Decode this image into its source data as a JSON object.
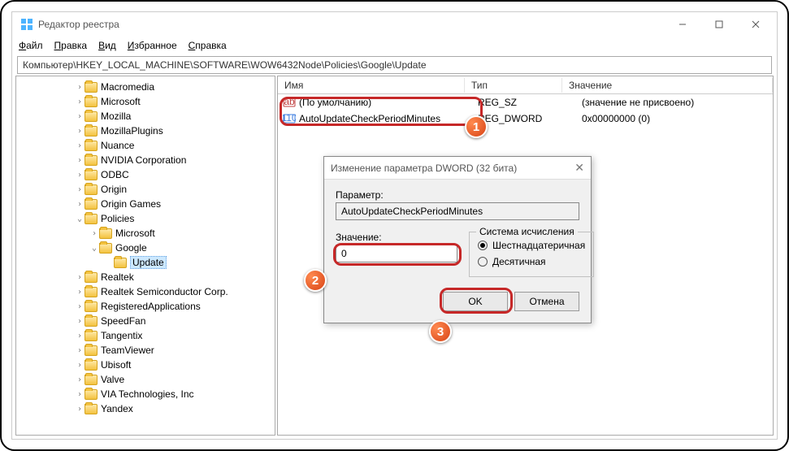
{
  "title": "Редактор реестра",
  "menu": [
    "Файл",
    "Правка",
    "Вид",
    "Избранное",
    "Справка"
  ],
  "path": "Компьютер\\HKEY_LOCAL_MACHINE\\SOFTWARE\\WOW6432Node\\Policies\\Google\\Update",
  "tree": [
    {
      "d": 4,
      "t": ">",
      "n": "Macromedia"
    },
    {
      "d": 4,
      "t": ">",
      "n": "Microsoft"
    },
    {
      "d": 4,
      "t": ">",
      "n": "Mozilla"
    },
    {
      "d": 4,
      "t": ">",
      "n": "MozillaPlugins"
    },
    {
      "d": 4,
      "t": ">",
      "n": "Nuance"
    },
    {
      "d": 4,
      "t": ">",
      "n": "NVIDIA Corporation"
    },
    {
      "d": 4,
      "t": ">",
      "n": "ODBC"
    },
    {
      "d": 4,
      "t": ">",
      "n": "Origin"
    },
    {
      "d": 4,
      "t": ">",
      "n": "Origin Games"
    },
    {
      "d": 4,
      "t": "v",
      "n": "Policies"
    },
    {
      "d": 5,
      "t": ">",
      "n": "Microsoft"
    },
    {
      "d": 5,
      "t": "v",
      "n": "Google"
    },
    {
      "d": 6,
      "t": "",
      "n": "Update",
      "sel": true
    },
    {
      "d": 4,
      "t": ">",
      "n": "Realtek"
    },
    {
      "d": 4,
      "t": ">",
      "n": "Realtek Semiconductor Corp."
    },
    {
      "d": 4,
      "t": ">",
      "n": "RegisteredApplications"
    },
    {
      "d": 4,
      "t": ">",
      "n": "SpeedFan"
    },
    {
      "d": 4,
      "t": ">",
      "n": "Tangentix"
    },
    {
      "d": 4,
      "t": ">",
      "n": "TeamViewer"
    },
    {
      "d": 4,
      "t": ">",
      "n": "Ubisoft"
    },
    {
      "d": 4,
      "t": ">",
      "n": "Valve"
    },
    {
      "d": 4,
      "t": ">",
      "n": "VIA Technologies, Inc"
    },
    {
      "d": 4,
      "t": ">",
      "n": "Yandex"
    }
  ],
  "list": {
    "cols": [
      "Имя",
      "Тип",
      "Значение"
    ],
    "rows": [
      {
        "icon": "str",
        "name": "(По умолчанию)",
        "type": "REG_SZ",
        "val": "(значение не присвоено)"
      },
      {
        "icon": "num",
        "name": "AutoUpdateCheckPeriodMinutes",
        "type": "REG_DWORD",
        "val": "0x00000000 (0)"
      }
    ]
  },
  "dialog": {
    "title": "Изменение параметра DWORD (32 бита)",
    "param_label": "Параметр:",
    "param_value": "AutoUpdateCheckPeriodMinutes",
    "value_label": "Значение:",
    "value_value": "0",
    "base_label": "Система исчисления",
    "hex": "Шестнадцатеричная",
    "dec": "Десятичная",
    "ok": "OK",
    "cancel": "Отмена"
  },
  "badges": [
    "1",
    "2",
    "3"
  ]
}
